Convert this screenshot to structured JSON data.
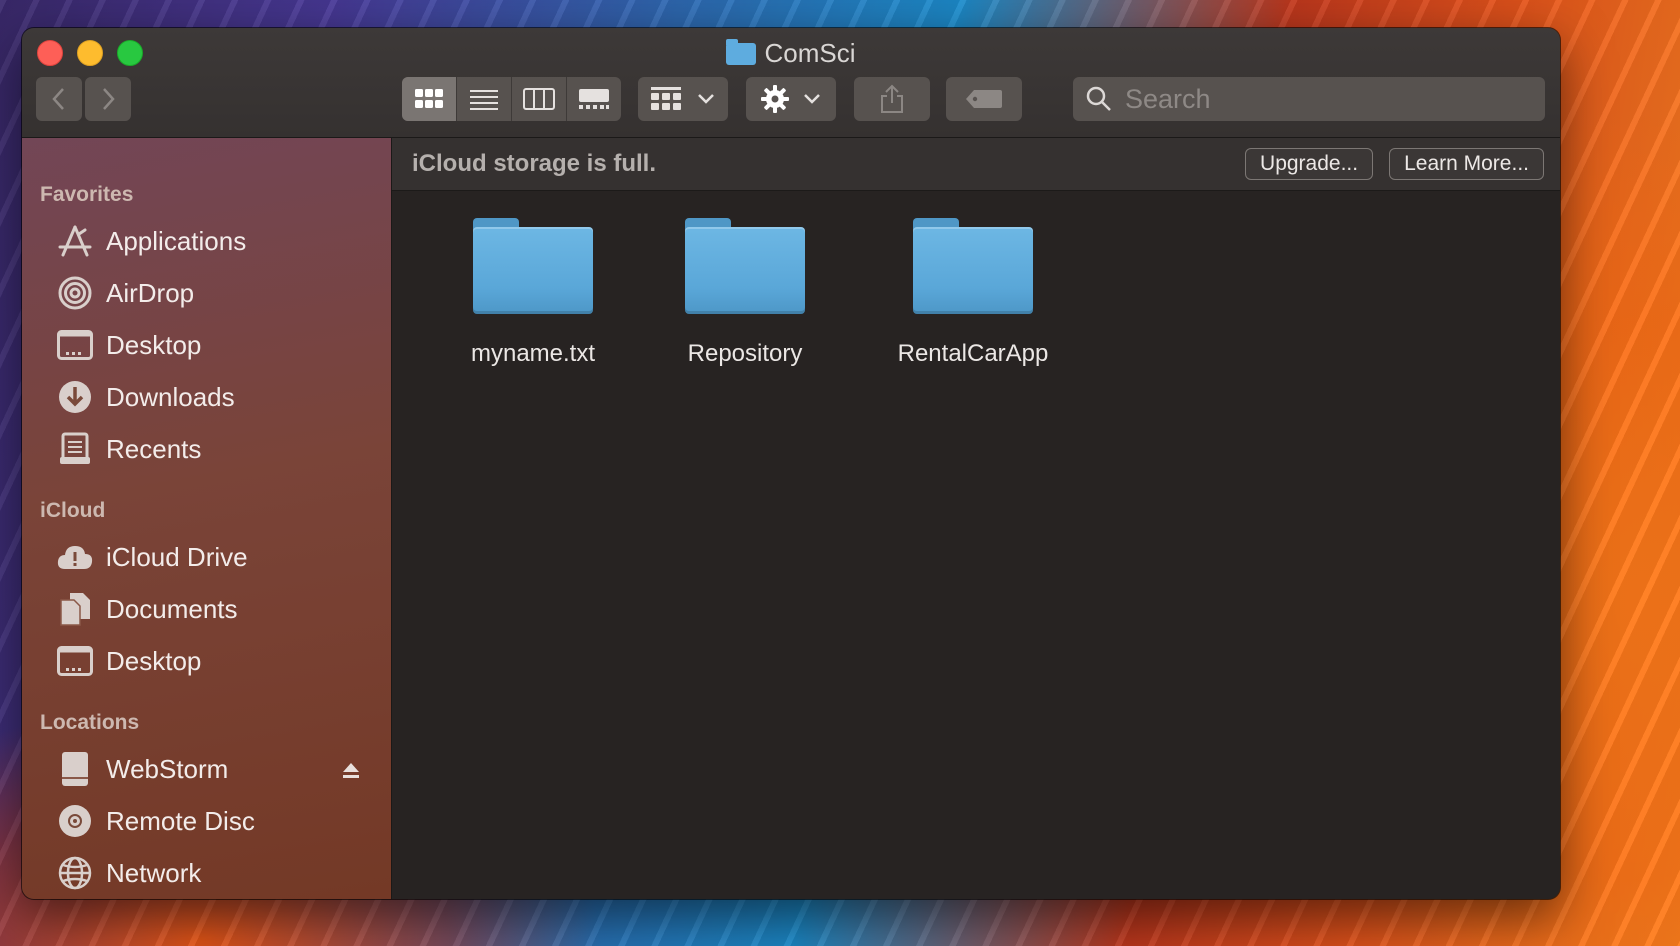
{
  "window": {
    "title": "ComSci"
  },
  "toolbar": {
    "back_icon": "chevron-left-icon",
    "forward_icon": "chevron-right-icon",
    "view_modes": [
      "icon-view",
      "list-view",
      "column-view",
      "gallery-view"
    ],
    "active_view": "icon-view",
    "group_icon": "grid-group-icon",
    "action_icon": "gear-icon",
    "share_icon": "share-icon",
    "tag_icon": "tag-icon",
    "search_placeholder": "Search"
  },
  "sidebar": {
    "sections": [
      {
        "title": "Favorites",
        "items": [
          {
            "label": "Applications",
            "icon": "applications-icon"
          },
          {
            "label": "AirDrop",
            "icon": "airdrop-icon"
          },
          {
            "label": "Desktop",
            "icon": "desktop-icon"
          },
          {
            "label": "Downloads",
            "icon": "downloads-icon"
          },
          {
            "label": "Recents",
            "icon": "recents-icon"
          }
        ]
      },
      {
        "title": "iCloud",
        "items": [
          {
            "label": "iCloud Drive",
            "icon": "icloud-drive-icon"
          },
          {
            "label": "Documents",
            "icon": "documents-icon"
          },
          {
            "label": "Desktop",
            "icon": "desktop-icon"
          }
        ]
      },
      {
        "title": "Locations",
        "items": [
          {
            "label": "WebStorm",
            "icon": "drive-icon"
          },
          {
            "label": "Remote Disc",
            "icon": "disc-icon"
          },
          {
            "label": "Network",
            "icon": "network-icon"
          }
        ]
      }
    ]
  },
  "banner": {
    "message": "iCloud storage is full.",
    "upgrade_label": "Upgrade...",
    "learn_more_label": "Learn More..."
  },
  "files": [
    {
      "name": "myname.txt",
      "type": "folder"
    },
    {
      "name": "Repository",
      "type": "folder"
    },
    {
      "name": "RentalCarApp",
      "type": "folder"
    }
  ],
  "colors": {
    "folder": "#5eacdf",
    "close": "#fe5f57",
    "minimize": "#febc2e",
    "maximize": "#28c840"
  }
}
